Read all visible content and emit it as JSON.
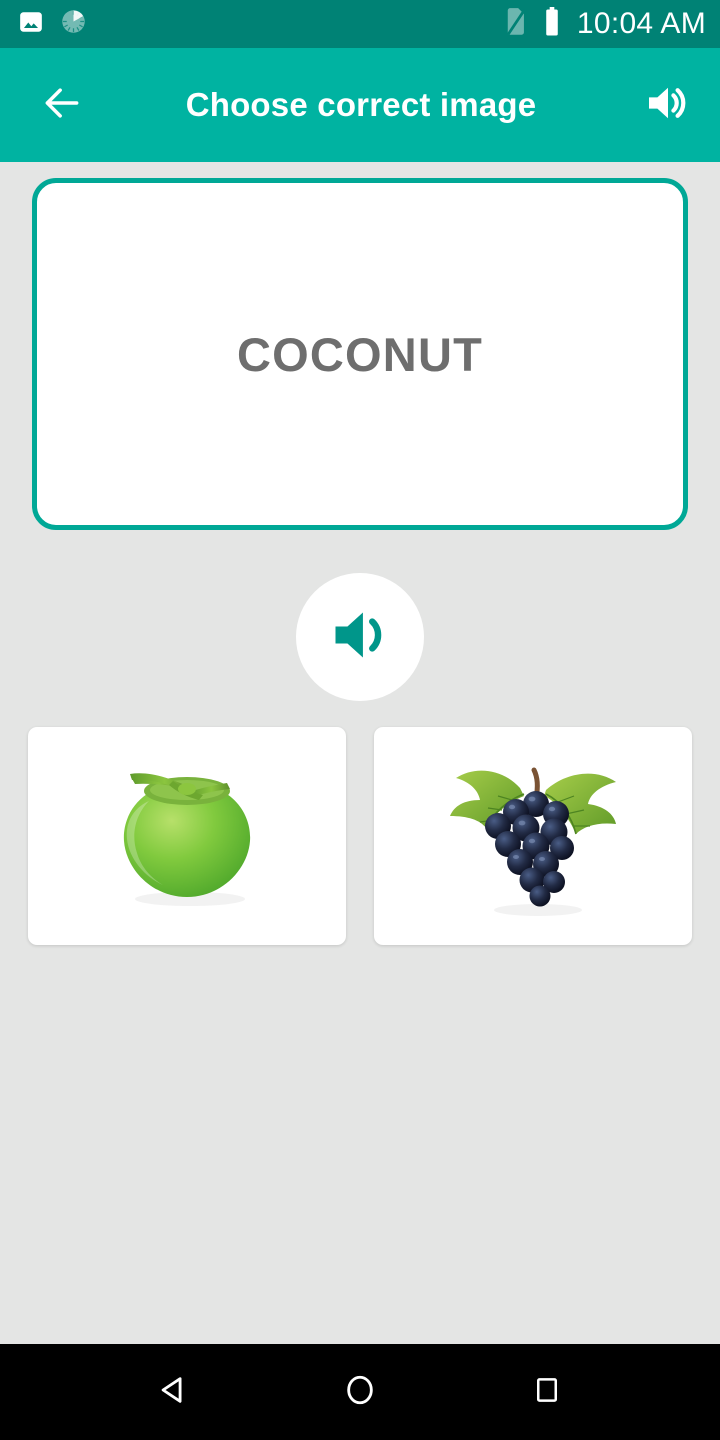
{
  "status_bar": {
    "time": "10:04 AM",
    "background": "#008275",
    "left_icons": [
      {
        "name": "image-icon",
        "label": "Screenshot / gallery notification"
      },
      {
        "name": "sync-progress-icon",
        "label": "Sync in progress"
      }
    ],
    "right_icons": [
      {
        "name": "no-sim-icon",
        "label": "No SIM card"
      },
      {
        "name": "battery-full-icon",
        "label": "Battery full"
      }
    ]
  },
  "app_bar": {
    "title": "Choose correct image",
    "background": "#00b3a1",
    "back_icon": "arrow-left-icon",
    "sound_icon": "volume-up-icon"
  },
  "main": {
    "background": "#e4e5e4",
    "word_card": {
      "word": "COCONUT",
      "border_color": "#00a896",
      "text_color": "#6e6e6e",
      "background": "#ffffff"
    },
    "speak_button": {
      "icon": "volume-up-icon",
      "icon_color": "#009688",
      "background": "#ffffff"
    },
    "options": [
      {
        "id": "option-coconut",
        "image_name": "green-coconut-image",
        "alt": "Green young coconut with stem"
      },
      {
        "id": "option-grapes",
        "image_name": "black-grapes-image",
        "alt": "Bunch of dark purple grapes with green leaves"
      }
    ]
  },
  "nav_bar": {
    "background": "#000000",
    "buttons": [
      {
        "name": "nav-back-button",
        "icon": "triangle-back-icon"
      },
      {
        "name": "nav-home-button",
        "icon": "circle-home-icon"
      },
      {
        "name": "nav-recents-button",
        "icon": "square-recents-icon"
      }
    ]
  }
}
